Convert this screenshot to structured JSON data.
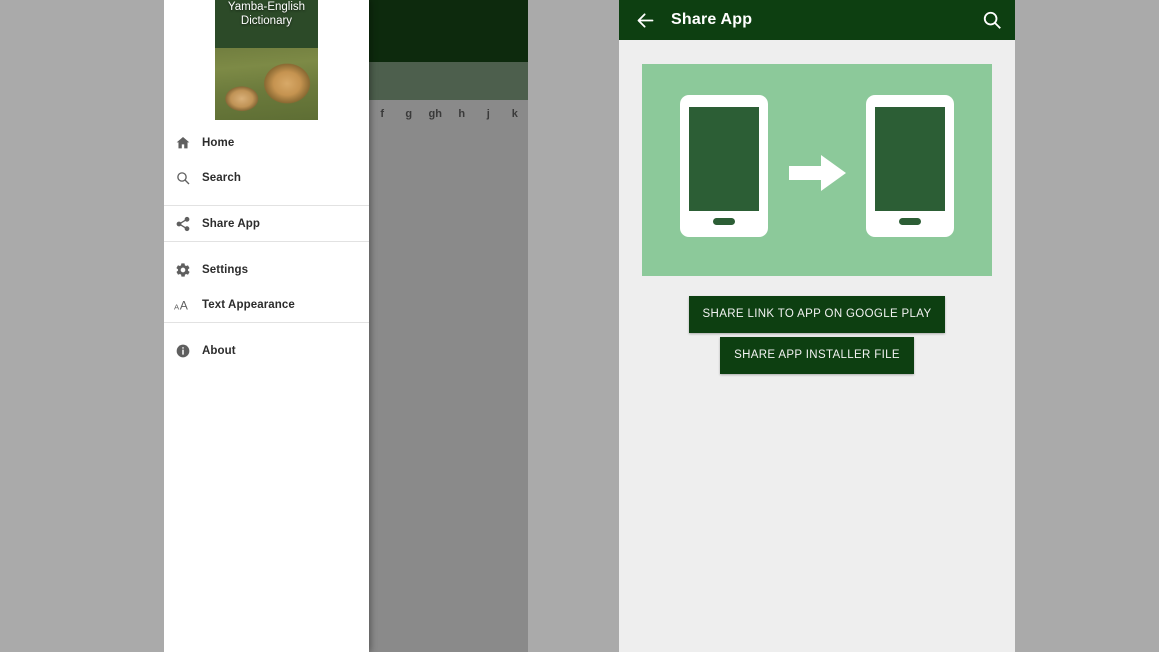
{
  "app": {
    "name": "Yamba-English Dictionary",
    "accent_dark_green": "#0d3f11",
    "accent_light_green": "#8cc99a",
    "phone_screen_green": "#2c5e35",
    "page_background": "#aaaaaa"
  },
  "left_screen": {
    "statusbar": {
      "badge_glyph": "▣"
    },
    "drawer": {
      "header": {
        "title_line1": "Yamba-English",
        "title_line2": "Dictionary"
      },
      "items": [
        {
          "label": "Home",
          "icon": "home-icon"
        },
        {
          "label": "Search",
          "icon": "search-icon"
        },
        {
          "label": "Share App",
          "icon": "share-icon"
        },
        {
          "label": "Settings",
          "icon": "gear-icon"
        },
        {
          "label": "Text Appearance",
          "icon": "text-size-icon"
        },
        {
          "label": "About",
          "icon": "info-icon"
        }
      ]
    },
    "dimmed_app": {
      "alphabet_tabs": [
        "f",
        "g",
        "gh",
        "h",
        "j",
        "k"
      ]
    }
  },
  "right_screen": {
    "appbar": {
      "back_icon": "arrow-left-icon",
      "title": "Share App",
      "search_icon": "search-icon"
    },
    "illustration": {
      "alt": "two phones with arrow between them",
      "arrow_icon": "arrow-right-icon"
    },
    "buttons": [
      {
        "label": "SHARE LINK TO APP ON GOOGLE PLAY"
      },
      {
        "label": "SHARE APP INSTALLER FILE"
      }
    ]
  }
}
